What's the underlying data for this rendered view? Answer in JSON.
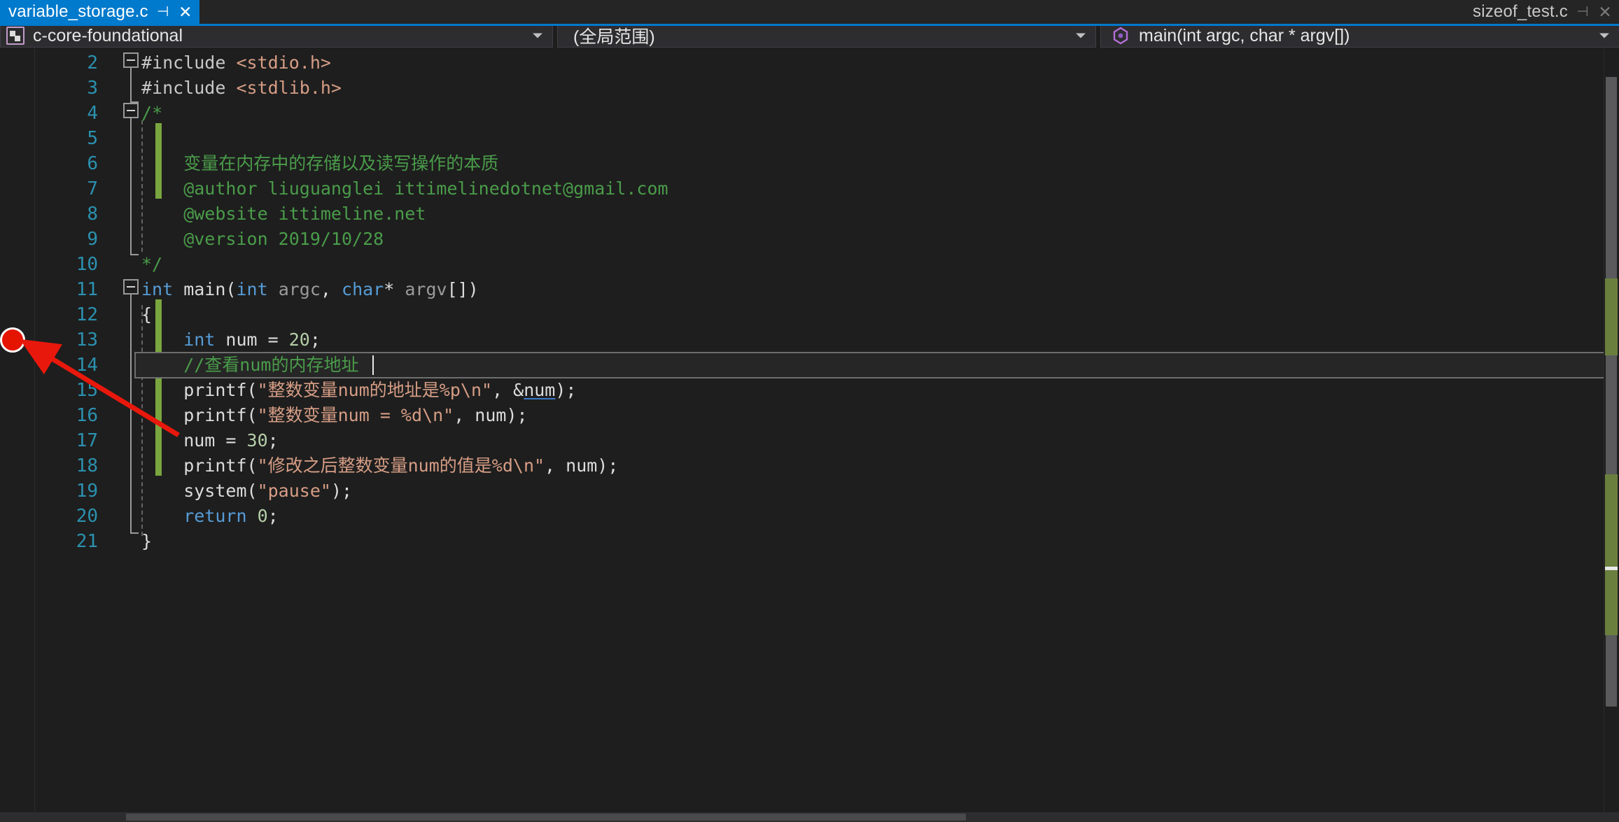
{
  "tabs": {
    "active": {
      "title": "variable_storage.c",
      "pin_icon": "pin-icon",
      "close_icon": "close-icon"
    },
    "inactive": {
      "title": "sizeof_test.c",
      "pin_icon": "pin-icon",
      "close_icon": "close-icon"
    }
  },
  "navbar": {
    "project": "c-core-foundational",
    "scope": "(全局范围)",
    "member": "main(int argc, char * argv[])",
    "project_icon": "project-icon",
    "member_icon": "method-icon",
    "caret_icon": "chevron-down-icon"
  },
  "editor": {
    "first_visible_line": 2,
    "cursor_line": 14,
    "breakpoint_line": 13,
    "lines": [
      {
        "n": 2,
        "segs": [
          {
            "t": "#include ",
            "c": "pp"
          },
          {
            "t": "<stdio.h>",
            "c": "hdr"
          }
        ]
      },
      {
        "n": 3,
        "segs": [
          {
            "t": "#include ",
            "c": "pp"
          },
          {
            "t": "<stdlib.h>",
            "c": "hdr"
          }
        ]
      },
      {
        "n": 4,
        "segs": [
          {
            "t": "/*",
            "c": "cmt"
          }
        ]
      },
      {
        "n": 5,
        "segs": []
      },
      {
        "n": 6,
        "segs": [
          {
            "t": "    变量在内存中的存储以及读写操作的本质",
            "c": "cmt"
          }
        ]
      },
      {
        "n": 7,
        "segs": [
          {
            "t": "    @author liuguanglei ittimelinedotnet@gmail.com",
            "c": "cmt"
          }
        ]
      },
      {
        "n": 8,
        "segs": [
          {
            "t": "    @website ittimeline.net",
            "c": "cmt"
          }
        ]
      },
      {
        "n": 9,
        "segs": [
          {
            "t": "    @version 2019/10/28",
            "c": "cmt"
          }
        ]
      },
      {
        "n": 10,
        "segs": [
          {
            "t": "*/",
            "c": "cmt"
          }
        ]
      },
      {
        "n": 11,
        "segs": [
          {
            "t": "int",
            "c": "kw"
          },
          {
            "t": " main(",
            "c": "ident"
          },
          {
            "t": "int",
            "c": "kw"
          },
          {
            "t": " ",
            "c": "ident"
          },
          {
            "t": "argc",
            "c": "param"
          },
          {
            "t": ", ",
            "c": "ident"
          },
          {
            "t": "char",
            "c": "kw"
          },
          {
            "t": "* ",
            "c": "ident"
          },
          {
            "t": "argv",
            "c": "param"
          },
          {
            "t": "[])",
            "c": "ident"
          }
        ]
      },
      {
        "n": 12,
        "segs": [
          {
            "t": "{",
            "c": "ident"
          }
        ]
      },
      {
        "n": 13,
        "segs": [
          {
            "t": "    int",
            "c": "kw"
          },
          {
            "t": " num = ",
            "c": "ident"
          },
          {
            "t": "20",
            "c": "num"
          },
          {
            "t": ";",
            "c": "ident"
          }
        ]
      },
      {
        "n": 14,
        "segs": [
          {
            "t": "    //查看num的内存地址",
            "c": "cmt"
          }
        ]
      },
      {
        "n": 15,
        "segs": [
          {
            "t": "    printf(",
            "c": "ident"
          },
          {
            "t": "\"整数变量num的地址是%p\\n\"",
            "c": "str"
          },
          {
            "t": ", &",
            "c": "ident"
          },
          {
            "t": "num",
            "c": "ulink"
          },
          {
            "t": ");",
            "c": "ident"
          }
        ]
      },
      {
        "n": 16,
        "segs": [
          {
            "t": "    printf(",
            "c": "ident"
          },
          {
            "t": "\"整数变量num = %d\\n\"",
            "c": "str"
          },
          {
            "t": ", num);",
            "c": "ident"
          }
        ]
      },
      {
        "n": 17,
        "segs": [
          {
            "t": "    num = ",
            "c": "ident"
          },
          {
            "t": "30",
            "c": "num"
          },
          {
            "t": ";",
            "c": "ident"
          }
        ]
      },
      {
        "n": 18,
        "segs": [
          {
            "t": "    printf(",
            "c": "ident"
          },
          {
            "t": "\"修改之后整数变量num的值是%d\\n\"",
            "c": "str"
          },
          {
            "t": ", num);",
            "c": "ident"
          }
        ]
      },
      {
        "n": 19,
        "segs": [
          {
            "t": "    system(",
            "c": "ident"
          },
          {
            "t": "\"pause\"",
            "c": "str"
          },
          {
            "t": ");",
            "c": "ident"
          }
        ]
      },
      {
        "n": 20,
        "segs": [
          {
            "t": "    return",
            "c": "kw"
          },
          {
            "t": " ",
            "c": "ident"
          },
          {
            "t": "0",
            "c": "num"
          },
          {
            "t": ";",
            "c": "ident"
          }
        ]
      },
      {
        "n": 21,
        "segs": [
          {
            "t": "}",
            "c": "ident"
          }
        ]
      }
    ]
  },
  "annotation": {
    "arrow_icon": "red-arrow-annotation",
    "color": "#e8180c",
    "points_to": "breakpoint-marker"
  },
  "colors": {
    "accent": "#007acc",
    "breakpoint": "#e51400",
    "change_bar": "#7aa63f",
    "comment": "#4a9c4a",
    "string": "#d69d85",
    "keyword": "#569cd6",
    "number": "#b5cea8",
    "linenumber": "#2b91af",
    "editor_bg": "#1e1e1e"
  }
}
